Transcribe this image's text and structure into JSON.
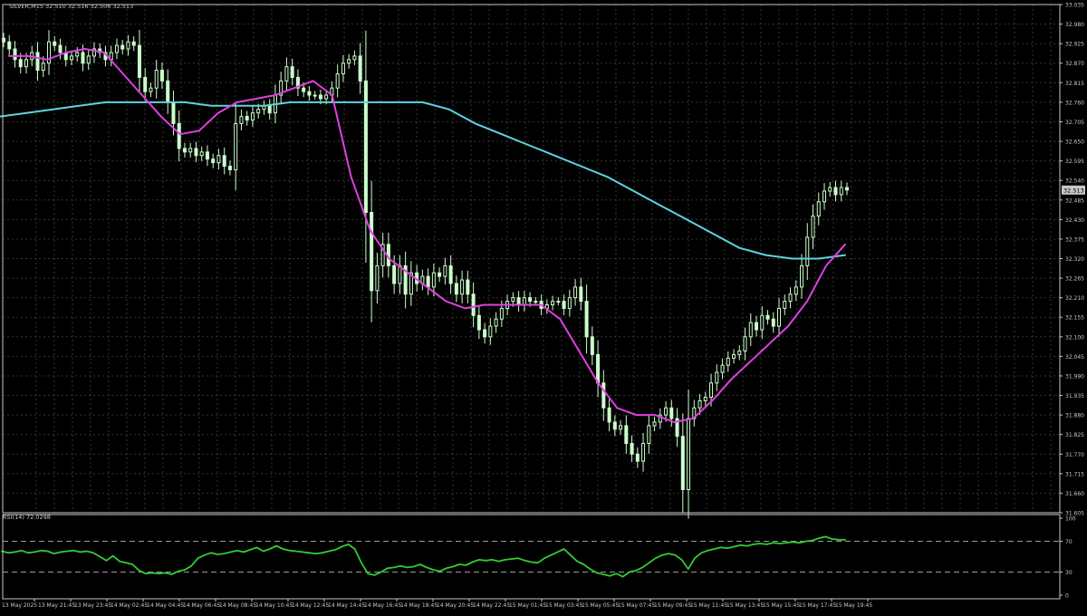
{
  "header": {
    "symbol_line": "SILVER,M15  32.510 32.516 32.506 32.513",
    "rsi_label": "RSI(14) 72.0298"
  },
  "colors": {
    "background": "#000000",
    "grid": "#2f3a2f",
    "axis": "#c8c8c8",
    "text": "#c8c8c8",
    "bull_candle": "#ccffcc",
    "bear_candle": "#ccffcc",
    "ma_fast": "#e040e0",
    "ma_slow": "#5fd3e0",
    "rsi_line": "#33cc33",
    "price_tag_bg": "#c8c8c8",
    "price_tag_text": "#000000"
  },
  "chart_data": [
    {
      "type": "candlestick",
      "title": "SILVER,M15  32.510 32.516 32.506 32.513",
      "timeframe": "M15",
      "current_price": "32.513",
      "ylim": [
        31.605,
        33.035
      ],
      "y_ticks": [
        "33.035",
        "32.980",
        "32.925",
        "32.870",
        "32.815",
        "32.760",
        "32.705",
        "32.650",
        "32.595",
        "32.540",
        "32.485",
        "32.430",
        "32.375",
        "32.320",
        "32.265",
        "32.210",
        "32.155",
        "32.100",
        "32.045",
        "31.990",
        "31.935",
        "31.880",
        "31.825",
        "31.770",
        "31.715",
        "31.660",
        "31.605"
      ],
      "x_ticks": [
        "13 May 2025",
        "13 May 21:45",
        "13 May 23:45",
        "14 May 02:45",
        "14 May 04:45",
        "14 May 06:45",
        "14 May 08:45",
        "14 May 10:45",
        "14 May 12:45",
        "14 May 14:45",
        "14 May 16:45",
        "14 May 18:45",
        "14 May 20:45",
        "14 May 22:45",
        "15 May 01:45",
        "15 May 03:45",
        "15 May 05:45",
        "15 May 07:45",
        "15 May 09:45",
        "15 May 11:45",
        "15 May 13:45",
        "15 May 15:45",
        "15 May 17:45",
        "15 May 19:45"
      ],
      "series": [
        {
          "name": "Close",
          "values": [
            32.93,
            32.91,
            32.88,
            32.86,
            32.88,
            32.9,
            32.85,
            32.87,
            32.93,
            32.92,
            32.9,
            32.88,
            32.89,
            32.9,
            32.87,
            32.89,
            32.91,
            32.9,
            32.88,
            32.9,
            32.92,
            32.91,
            32.93,
            32.92,
            32.83,
            32.79,
            32.8,
            32.85,
            32.82,
            32.76,
            32.7,
            32.63,
            32.62,
            32.63,
            32.61,
            32.62,
            32.6,
            32.59,
            32.61,
            32.58,
            32.57,
            32.7,
            32.72,
            32.71,
            32.73,
            32.74,
            32.75,
            32.73,
            32.78,
            32.82,
            32.86,
            32.83,
            32.8,
            32.79,
            32.78,
            32.78,
            32.77,
            32.78,
            32.8,
            32.84,
            32.87,
            32.88,
            32.89,
            32.82,
            32.45,
            32.23,
            32.3,
            32.36,
            32.3,
            32.25,
            32.3,
            32.22,
            32.28,
            32.25,
            32.27,
            32.24,
            32.28,
            32.27,
            32.3,
            32.25,
            32.22,
            32.26,
            32.22,
            32.16,
            32.12,
            32.1,
            32.13,
            32.15,
            32.18,
            32.2,
            32.21,
            32.19,
            32.21,
            32.2,
            32.2,
            32.18,
            32.19,
            32.2,
            32.2,
            32.18,
            32.21,
            32.24,
            32.2,
            32.1,
            32.05,
            31.97,
            31.9,
            31.86,
            31.84,
            31.85,
            31.8,
            31.77,
            31.75,
            31.8,
            31.85,
            31.86,
            31.88,
            31.9,
            31.87,
            31.82,
            31.67,
            31.87,
            31.9,
            31.92,
            31.93,
            31.97,
            32.0,
            32.02,
            32.04,
            32.05,
            32.06,
            32.1,
            32.14,
            32.12,
            32.16,
            32.15,
            32.13,
            32.18,
            32.2,
            32.22,
            32.24,
            32.3,
            32.38,
            32.44,
            32.48,
            32.51,
            32.52,
            32.5,
            32.52,
            32.513
          ]
        },
        {
          "name": "MA fast",
          "values": [
            32.89,
            32.89,
            32.88,
            32.9,
            32.91,
            32.9,
            32.84,
            32.78,
            32.72,
            32.67,
            32.68,
            32.73,
            32.76,
            32.77,
            32.78,
            32.8,
            32.82,
            32.78,
            32.55,
            32.4,
            32.32,
            32.28,
            32.24,
            32.2,
            32.18,
            32.19,
            32.19,
            32.19,
            32.19,
            32.15,
            32.06,
            31.97,
            31.9,
            31.88,
            31.88,
            31.86,
            31.87,
            31.92,
            31.98,
            32.03,
            32.08,
            32.13,
            32.2,
            32.3,
            32.36
          ]
        },
        {
          "name": "MA slow",
          "values": [
            32.72,
            32.73,
            32.74,
            32.75,
            32.76,
            32.76,
            32.76,
            32.76,
            32.75,
            32.75,
            32.75,
            32.76,
            32.76,
            32.76,
            32.76,
            32.76,
            32.76,
            32.74,
            32.7,
            32.67,
            32.64,
            32.61,
            32.58,
            32.55,
            32.51,
            32.47,
            32.43,
            32.39,
            32.35,
            32.33,
            32.32,
            32.32,
            32.33
          ]
        }
      ]
    },
    {
      "type": "line",
      "title": "RSI(14) 72.0298",
      "ylim": [
        0,
        100
      ],
      "y_ticks": [
        "100",
        "70",
        "30",
        "0"
      ],
      "levels": [
        70,
        30
      ],
      "series": [
        {
          "name": "RSI(14)",
          "values": [
            57,
            55,
            56,
            58,
            55,
            56,
            58,
            57,
            54,
            56,
            57,
            58,
            56,
            57,
            55,
            50,
            45,
            51,
            44,
            42,
            40,
            32,
            28,
            29,
            28,
            29,
            27,
            31,
            33,
            38,
            48,
            52,
            55,
            53,
            54,
            56,
            58,
            56,
            59,
            62,
            57,
            60,
            64,
            60,
            58,
            57,
            56,
            55,
            54,
            55,
            57,
            59,
            63,
            66,
            60,
            42,
            28,
            26,
            30,
            35,
            36,
            38,
            36,
            37,
            40,
            36,
            33,
            31,
            35,
            37,
            40,
            39,
            43,
            46,
            45,
            46,
            44,
            46,
            47,
            48,
            45,
            43,
            42,
            48,
            52,
            56,
            60,
            52,
            44,
            40,
            34,
            29,
            27,
            25,
            28,
            24,
            30,
            32,
            36,
            42,
            48,
            52,
            54,
            52,
            46,
            34,
            48,
            55,
            58,
            60,
            62,
            61,
            63,
            65,
            64,
            66,
            67,
            66,
            68,
            67,
            68,
            69,
            68,
            70,
            71,
            74,
            76,
            73,
            72,
            72.03
          ]
        }
      ]
    }
  ]
}
